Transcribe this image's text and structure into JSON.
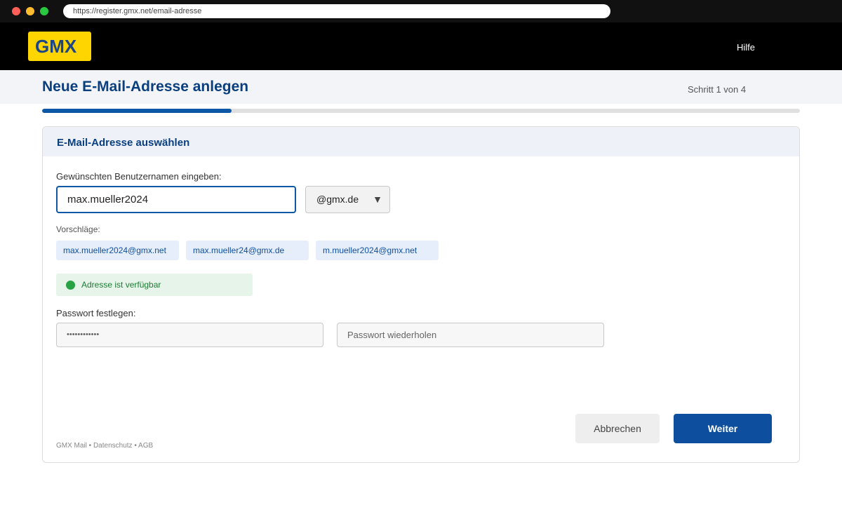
{
  "browser": {
    "url": "https://register.gmx.net/email-adresse"
  },
  "header": {
    "logo": "GMX",
    "help": "Hilfe"
  },
  "page": {
    "title": "Neue E-Mail-Adresse anlegen",
    "step": "Schritt 1 von 4",
    "progress_fraction": 0.25
  },
  "card": {
    "title": "E-Mail-Adresse auswählen",
    "username_label": "Gewünschten Benutzernamen eingeben:",
    "username_value": "max.mueller2024",
    "domain_value": "@gmx.de",
    "suggestions_label": "Vorschläge:",
    "suggestions": [
      "max.mueller2024@gmx.net",
      "max.mueller24@gmx.de",
      "m.mueller2024@gmx.net"
    ],
    "availability": "Adresse ist verfügbar",
    "password_label": "Passwort festlegen:",
    "password_value": "••••••••••••",
    "password_repeat_placeholder": "Passwort wiederholen",
    "cancel": "Abbrechen",
    "next": "Weiter",
    "footer": "GMX Mail • Datenschutz • AGB"
  },
  "colors": {
    "brand_yellow": "#ffd500",
    "primary_blue": "#0d4f9e",
    "success_green": "#27a345"
  },
  "icons": {
    "window_controls": [
      "close-dot",
      "minimize-dot",
      "maximize-dot"
    ],
    "select_caret": "caret-down-icon",
    "status": "status-dot-icon"
  }
}
